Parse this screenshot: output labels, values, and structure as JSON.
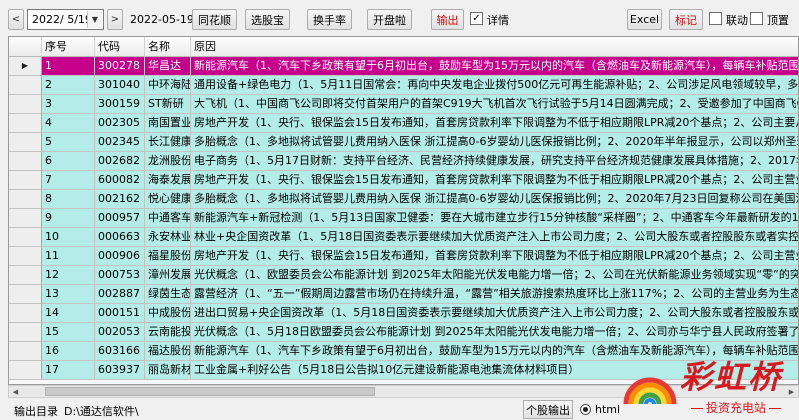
{
  "toolbar": {
    "prev": "<",
    "next": ">",
    "date_value": "2022/ 5/19",
    "date_text": "2022-05-19",
    "btn_tonghuashun": "同花顺",
    "btn_xuangubao": "选股宝",
    "btn_huanshoulv": "换手率",
    "btn_kaipanla": "开盘啦",
    "btn_output": "输出",
    "detail_label": "详情",
    "detail_checked": true,
    "btn_excel": "Excel",
    "btn_biaoji": "标记",
    "liandong_label": "联动",
    "liandong_checked": false,
    "zhiding_label": "顶置",
    "zhiding_checked": false
  },
  "table": {
    "headers": [
      "序号",
      "代码",
      "名称",
      "原因"
    ],
    "selected_row_index": 0,
    "row_marker": "▶",
    "rows": [
      [
        "1",
        "300278",
        "华昌达",
        "新能源汽车（1、汽车下乡政策有望于6月初出台，鼓励车型为15万元以内的汽车（含燃油车及新能源汽车），每辆车补贴范围或在3000"
      ],
      [
        "2",
        "301040",
        "中环海陆",
        "通用设备+绿色电力（1、5月11日国常会：再向中央发电企业拨付500亿元可再生能源补贴；2、公司涉足风电领域较早，多年来通过对"
      ],
      [
        "3",
        "300159",
        "ST新研",
        "大飞机（1、中国商飞公司即将交付首架用户的首架C919大飞机首次飞行试验于5月14日圆满完成；2、受邀参加了中国商飞C919改进工"
      ],
      [
        "4",
        "002305",
        "南国置业",
        "房地产开发（1、央行、银保监会15日发布通知，首套房贷款利率下限调整为不低于相应期限LPR减20个基点；2、公司主要从事房地产"
      ],
      [
        "5",
        "002345",
        "长江健康",
        "多胎概念（1、多地拟将试管婴儿费用纳入医保 浙江提高0-6岁婴幼儿医保报销比例；2、2020年半年报显示，公司以郑州圣玛妇产医院"
      ],
      [
        "6",
        "002682",
        "龙洲股份",
        "电子商务（1、5月17日财新：支持平台经济、民营经济持续健康发展，研究支持平台经济规范健康发展具体措施；2、2017年收购了"
      ],
      [
        "7",
        "600082",
        "海泰发展",
        "房地产开发（1、央行、银保监会15日发布通知，首套房贷款利率下限调整为不低于相应期限LPR减20个基点；2、公司主营业务为房地"
      ],
      [
        "8",
        "002162",
        "悦心健康",
        "多胎概念（1、多地拟将试管婴儿费用纳入医保 浙江提高0-6岁婴幼儿医保报销比例；2、2020年7月23日回复称公司在美国洛杉矶投资"
      ],
      [
        "9",
        "000957",
        "中通客车",
        "新能源汽车+新冠检测（1、5月13日国家卫健委：要在大城市建立步行15分钟核酸“采样圈”；2、中通客车今年最新研发的13米核酸"
      ],
      [
        "10",
        "000663",
        "永安林业",
        "林业+央企国资改革（1、5月18日国资委表示要继续加大优质资产注入上市公司力度；2、公司大股东或者控股股东或者实控人涉及央企"
      ],
      [
        "11",
        "000906",
        "福星股份",
        "房地产开发（1、央行、银保监会15日发布通知，首套房贷款利率下限调整为不低于相应期限LPR减20个基点；2、公司主营业务为房地"
      ],
      [
        "12",
        "000753",
        "漳州发展",
        "光伏概念（1、欧盟委员会公布能源计划 到2025年太阳能光伏发电能力增一倍；2、公司在光伏新能源业务领域实现“零”的突破，与一"
      ],
      [
        "13",
        "002887",
        "绿茵生态",
        "露营经济（1、“五一”假期周边露营市场仍在持续升温，“露营”相关旅游搜索热度环比上涨117%；2、公司的主营业务为生态保护和"
      ],
      [
        "14",
        "000151",
        "中成股份",
        "进出口贸易+央企国资改革（1、5月18日国资委表示要继续加大优质资产注入上市公司力度；2、公司大股东或者控股股东或者实控人涉及"
      ],
      [
        "15",
        "002053",
        "云南能投",
        "光伏概念（1、5月18日欧盟委员会公布能源计划 到2025年太阳能光伏发电能力增一倍；2、公司亦与华宁县人民政府签署了投资开发光"
      ],
      [
        "16",
        "603166",
        "福达股份",
        "新能源汽车（1、汽车下乡政策有望于6月初出台，鼓励车型为15万元以内的汽车（含燃油车及新能源汽车），每辆车补贴范围或在3000"
      ],
      [
        "17",
        "603937",
        "丽岛新材",
        "工业金属+利好公告（5月18日公告拟10亿元建设新能源电池集流体材料项目）"
      ]
    ]
  },
  "scrollbar": {
    "left_arrow": "◀",
    "right_arrow": "▶"
  },
  "status": {
    "label": "输出目录",
    "path": "D:\\通达信软件\\",
    "single_output_btn": "个股输出",
    "radio_label": "html",
    "radio_checked": true
  },
  "watermark": {
    "title": "彩虹桥",
    "subtitle": "投资充电站"
  }
}
